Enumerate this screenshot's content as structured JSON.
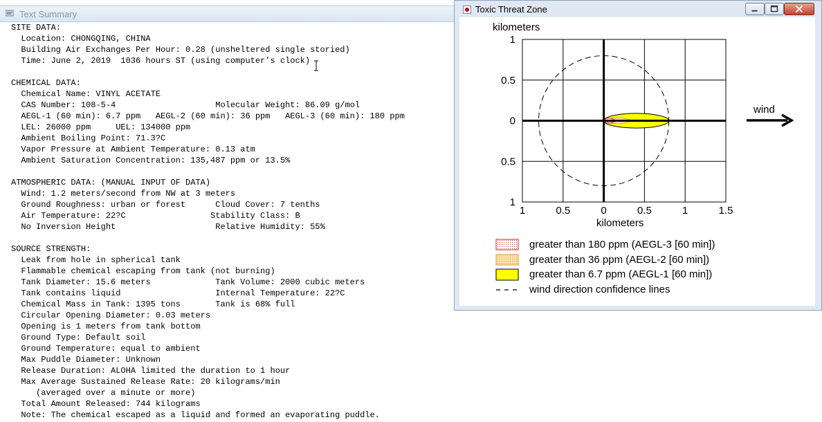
{
  "text_summary": {
    "title": "Text Summary",
    "lines": [
      "SITE DATA:",
      "  Location: CHONGQING, CHINA",
      "  Building Air Exchanges Per Hour: 0.28 (unsheltered single storied)",
      "  Time: June 2, 2019  1036 hours ST (using computer's clock)",
      "",
      "CHEMICAL DATA:",
      "  Chemical Name: VINYL ACETATE",
      "  CAS Number: 108-5-4                    Molecular Weight: 86.09 g/mol",
      "  AEGL-1 (60 min): 6.7 ppm   AEGL-2 (60 min): 36 ppm   AEGL-3 (60 min): 180 ppm",
      "  LEL: 26000 ppm     UEL: 134000 ppm",
      "  Ambient Boiling Point: 71.3?C",
      "  Vapor Pressure at Ambient Temperature: 0.13 atm",
      "  Ambient Saturation Concentration: 135,487 ppm or 13.5%",
      "",
      "ATMOSPHERIC DATA: (MANUAL INPUT OF DATA)",
      "  Wind: 1.2 meters/second from NW at 3 meters",
      "  Ground Roughness: urban or forest      Cloud Cover: 7 tenths",
      "  Air Temperature: 22?C                 Stability Class: B",
      "  No Inversion Height                    Relative Humidity: 55%",
      "",
      "SOURCE STRENGTH:",
      "  Leak from hole in spherical tank",
      "  Flammable chemical escaping from tank (not burning)",
      "  Tank Diameter: 15.6 meters             Tank Volume: 2000 cubic meters",
      "  Tank contains liquid                   Internal Temperature: 22?C",
      "  Chemical Mass in Tank: 1395 tons       Tank is 68% full",
      "  Circular Opening Diameter: 0.03 meters",
      "  Opening is 1 meters from tank bottom",
      "  Ground Type: Default soil",
      "  Ground Temperature: equal to ambient",
      "  Max Puddle Diameter: Unknown",
      "  Release Duration: ALOHA limited the duration to 1 hour",
      "  Max Average Sustained Release Rate: 20 kilograms/min",
      "     (averaged over a minute or more)",
      "  Total Amount Released: 744 kilograms",
      "  Note: The chemical escaped as a liquid and formed an evaporating puddle."
    ]
  },
  "threat_zone": {
    "title": "Toxic Threat Zone",
    "wind_label": "wind",
    "legend": [
      {
        "label": "greater than 180 ppm (AEGL-3 [60 min])",
        "swatch": "red-dotted",
        "color": "#e0201a"
      },
      {
        "label": "greater than 36 ppm (AEGL-2 [60 min])",
        "swatch": "orange-dotted",
        "color": "#f0a040"
      },
      {
        "label": "greater than 6.7 ppm (AEGL-1 [60 min])",
        "swatch": "yellow-solid",
        "color": "#ffff00"
      },
      {
        "label": "wind direction confidence lines",
        "swatch": "dashed-line",
        "color": "#000000"
      }
    ],
    "icons": {
      "minimize": "minimize-icon",
      "maximize": "maximize-icon",
      "close": "close-icon",
      "app": "threat-zone-app-icon"
    }
  },
  "chart_data": {
    "type": "scatter",
    "title": "",
    "xlabel": "kilometers",
    "ylabel": "kilometers",
    "xlim": [
      -1,
      1.5
    ],
    "ylim": [
      -1,
      1
    ],
    "x_ticks": [
      -1,
      -0.5,
      0,
      0.5,
      1,
      1.5
    ],
    "x_tick_labels": [
      "1",
      "0.5",
      "0",
      "0.5",
      "1",
      "1.5"
    ],
    "y_ticks": [
      1,
      0.5,
      0,
      -0.5,
      -1
    ],
    "y_tick_labels": [
      "1",
      "0.5",
      "0",
      "0.5",
      "1"
    ],
    "grid": true,
    "zones": [
      {
        "name": "AEGL-1",
        "x_from": 0.0,
        "x_to": 0.8,
        "half_width": 0.09,
        "color": "#ffff00"
      },
      {
        "name": "AEGL-2",
        "x_from": 0.0,
        "x_to": 0.33,
        "half_width": 0.035,
        "color": "#f0a040"
      },
      {
        "name": "AEGL-3",
        "x_from": 0.0,
        "x_to": 0.13,
        "half_width": 0.03,
        "color": "#e0201a"
      }
    ],
    "confidence_circle_radius_km": 0.8
  }
}
